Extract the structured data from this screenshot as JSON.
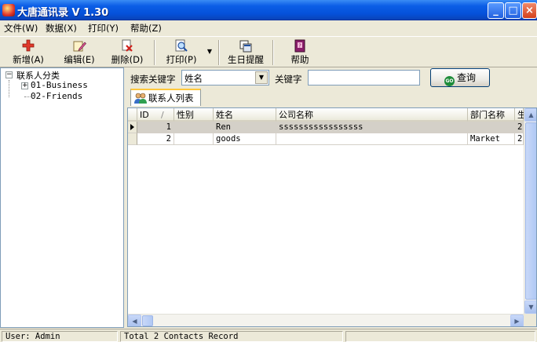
{
  "window": {
    "title": "大唐通讯录 V 1.30",
    "controls": {
      "minimize": "_",
      "maximize": "□",
      "close": "×"
    }
  },
  "menu": [
    {
      "label": "文件(W)"
    },
    {
      "label": "数据(X)"
    },
    {
      "label": "打印(Y)"
    },
    {
      "label": "帮助(Z)"
    }
  ],
  "toolbar": {
    "add": "新增(A)",
    "edit": "编辑(E)",
    "delete": "删除(D)",
    "print": "打印(P)",
    "birthday": "生日提醒",
    "help": "帮助"
  },
  "tree": {
    "root": "联系人分类",
    "children": [
      {
        "label": "01-Business",
        "expander": "+"
      },
      {
        "label": "02-Friends"
      }
    ],
    "root_expander": "−"
  },
  "search": {
    "label": "搜索关键字",
    "field_value": "姓名",
    "keyword_label": "关键字",
    "keyword_value": "",
    "query_button": "查询",
    "go_icon_text": "GO"
  },
  "tab": {
    "label": "联系人列表"
  },
  "grid": {
    "columns": [
      "ID",
      "性别",
      "姓名",
      "公司名称",
      "部门名称",
      "生"
    ],
    "sort_marker": "/",
    "rows": [
      {
        "id": "1",
        "gender": "",
        "name": "Ren",
        "company": "sssssssssssssssss",
        "department": "",
        "extra": "2",
        "selected": true
      },
      {
        "id": "2",
        "gender": "",
        "name": "goods",
        "company": "",
        "department": "Market",
        "extra": "2",
        "selected": false
      }
    ]
  },
  "status": {
    "user": "User: Admin",
    "record_count": "Total 2 Contacts Record",
    "extra": ""
  },
  "colors": {
    "titlebar": "#0551DA",
    "window_bg": "#ECE9D8",
    "selected_row": "#D4D0C8"
  }
}
